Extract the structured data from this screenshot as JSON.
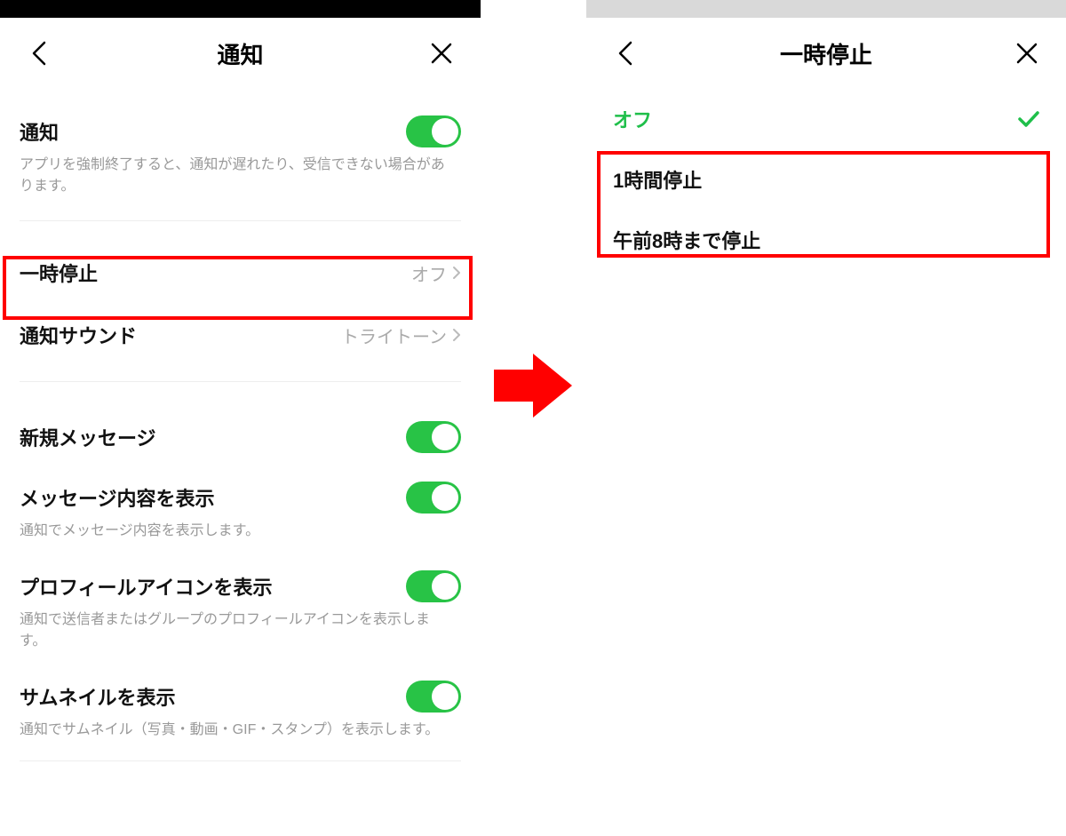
{
  "left": {
    "title": "通知",
    "notif_label": "通知",
    "notif_desc": "アプリを強制終了すると、通知が遅れたり、受信できない場合があります。",
    "pause_label": "一時停止",
    "pause_value": "オフ",
    "sound_label": "通知サウンド",
    "sound_value": "トライトーン",
    "new_msg_label": "新規メッセージ",
    "msg_content_label": "メッセージ内容を表示",
    "msg_content_desc": "通知でメッセージ内容を表示します。",
    "profile_icon_label": "プロフィールアイコンを表示",
    "profile_icon_desc": "通知で送信者またはグループのプロフィールアイコンを表示します。",
    "thumb_label": "サムネイルを表示",
    "thumb_desc": "通知でサムネイル（写真・動画・GIF・スタンプ）を表示します。"
  },
  "right": {
    "title": "一時停止",
    "off_label": "オフ",
    "opt1": "1時間停止",
    "opt2": "午前8時まで停止"
  }
}
